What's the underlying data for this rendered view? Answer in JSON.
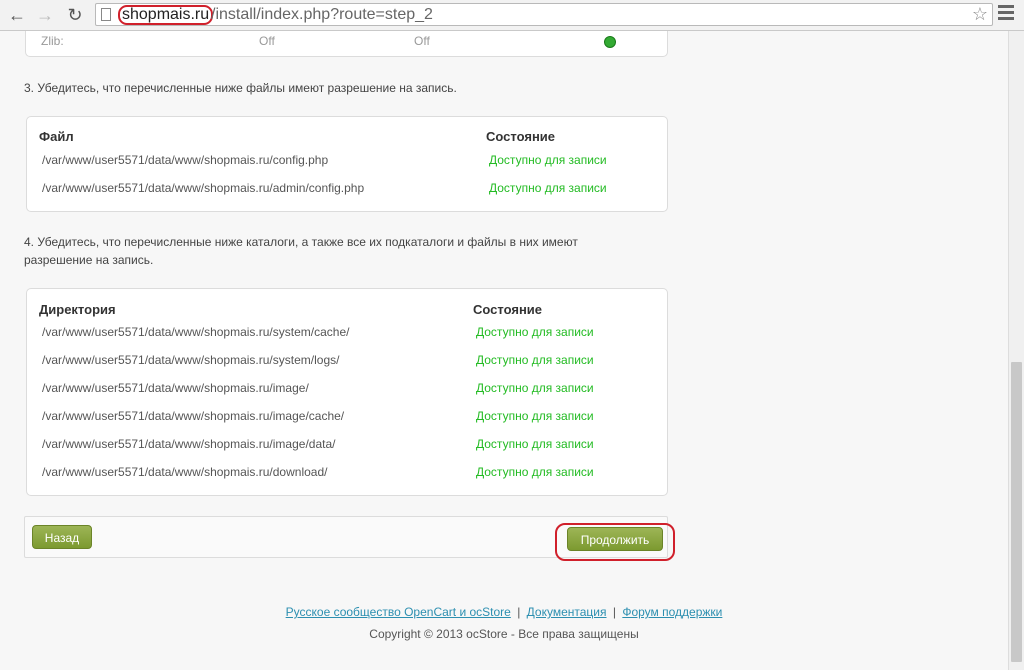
{
  "browser": {
    "url_host": "shopmais.ru",
    "url_path": "/install/index.php?route=step_2"
  },
  "top_section": {
    "col1": "Zlib:",
    "col2": "Off",
    "col3": "Off"
  },
  "step3": {
    "instruction": "3. Убедитесь, что перечисленные ниже файлы имеют разрешение на запись.",
    "header_file": "Файл",
    "header_status": "Состояние",
    "rows": [
      {
        "path": "/var/www/user5571/data/www/shopmais.ru/config.php",
        "status": "Доступно для записи"
      },
      {
        "path": "/var/www/user5571/data/www/shopmais.ru/admin/config.php",
        "status": "Доступно для записи"
      }
    ]
  },
  "step4": {
    "instruction": "4. Убедитесь, что перечисленные ниже каталоги, а также все их подкаталоги и файлы в них имеют разрешение на запись.",
    "header_dir": "Директория",
    "header_status": "Состояние",
    "rows": [
      {
        "path": "/var/www/user5571/data/www/shopmais.ru/system/cache/",
        "status": "Доступно для записи"
      },
      {
        "path": "/var/www/user5571/data/www/shopmais.ru/system/logs/",
        "status": "Доступно для записи"
      },
      {
        "path": "/var/www/user5571/data/www/shopmais.ru/image/",
        "status": "Доступно для записи"
      },
      {
        "path": "/var/www/user5571/data/www/shopmais.ru/image/cache/",
        "status": "Доступно для записи"
      },
      {
        "path": "/var/www/user5571/data/www/shopmais.ru/image/data/",
        "status": "Доступно для записи"
      },
      {
        "path": "/var/www/user5571/data/www/shopmais.ru/download/",
        "status": "Доступно для записи"
      }
    ]
  },
  "buttons": {
    "back": "Назад",
    "next": "Продолжить"
  },
  "footer": {
    "link_community": "Русское сообщество OpenCart и ocStore",
    "link_docs": "Документация",
    "link_forum": "Форум поддержки",
    "separator": "|",
    "copyright": "Copyright © 2013 ocStore - Все права защищены"
  },
  "colors": {
    "status_green": "#22bb22",
    "button_olive": "#8aa83f",
    "link_blue": "#2c8fb0",
    "highlight_red": "#d0202b"
  }
}
